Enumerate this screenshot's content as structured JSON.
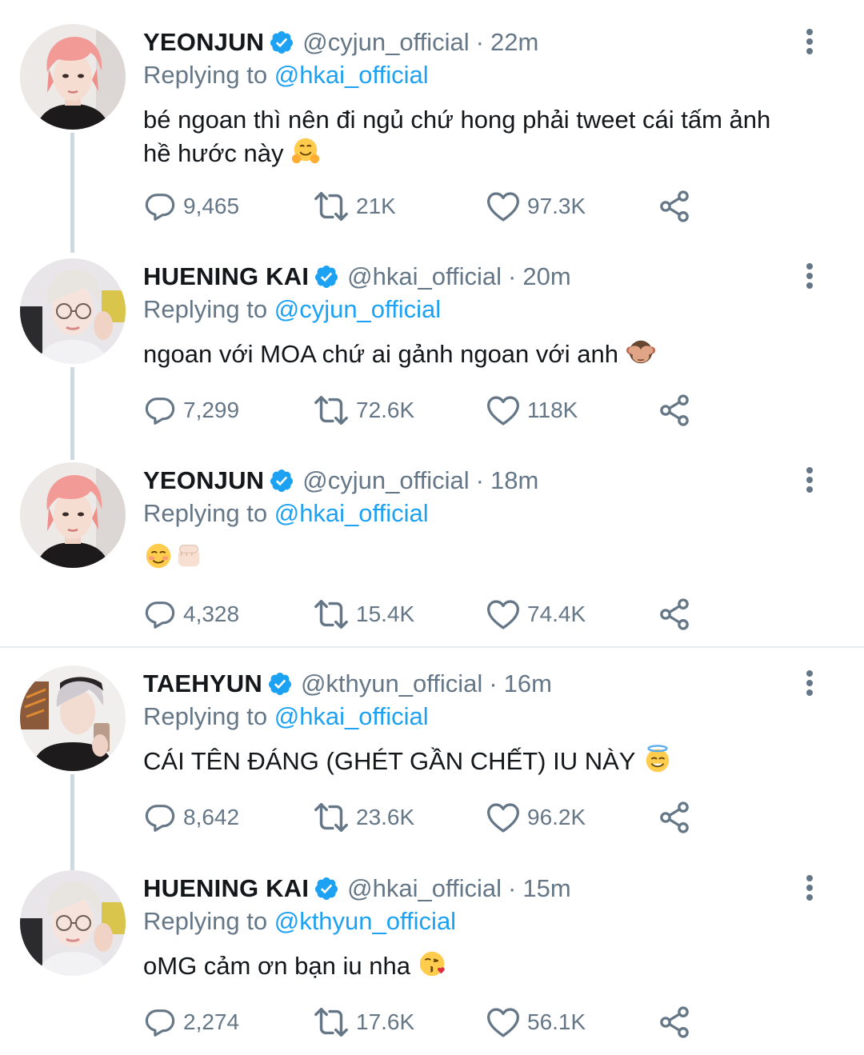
{
  "tweets": [
    {
      "name": "YEONJUN",
      "handle": "@cyjun_official",
      "time": "22m",
      "replying_label": "Replying to",
      "replying_to": "@hkai_official",
      "text_line1": "bé ngoan thì nên đi ngủ chứ hong phải tweet cái tấm ảnh",
      "text_line2": "hề hước này",
      "emoji": "hugging-face",
      "replies": "9,465",
      "retweets": "21K",
      "likes": "97.3K",
      "avatar_icon": "pink-hair-avatar"
    },
    {
      "name": "HUENING KAI",
      "handle": "@hkai_official",
      "time": "20m",
      "replying_label": "Replying to",
      "replying_to": "@cyjun_official",
      "text_line1": "ngoan với MOA chứ ai gảnh ngoan với anh",
      "emoji": "see-no-evil-monkey",
      "replies": "7,299",
      "retweets": "72.6K",
      "likes": "118K",
      "avatar_icon": "blonde-glasses-avatar"
    },
    {
      "name": "YEONJUN",
      "handle": "@cyjun_official",
      "time": "18m",
      "replying_label": "Replying to",
      "replying_to": "@hkai_official",
      "emoji": "smiling-face-and-fist",
      "replies": "4,328",
      "retweets": "15.4K",
      "likes": "74.4K",
      "avatar_icon": "pink-hair-avatar"
    },
    {
      "name": "TAEHYUN",
      "handle": "@kthyun_official",
      "time": "16m",
      "replying_label": "Replying to",
      "replying_to": "@hkai_official",
      "text_line1": "CÁI TÊN ĐÁNG (GHÉT GẦN CHẾT) IU NÀY",
      "emoji": "smiling-face-with-halo",
      "replies": "8,642",
      "retweets": "23.6K",
      "likes": "96.2K",
      "avatar_icon": "mirror-selfie-avatar"
    },
    {
      "name": "HUENING KAI",
      "handle": "@hkai_official",
      "time": "15m",
      "replying_label": "Replying to",
      "replying_to": "@kthyun_official",
      "text_line1": "oMG cảm ơn bạn iu nha",
      "emoji": "face-blowing-kiss",
      "replies": "2,274",
      "retweets": "17.6K",
      "likes": "56.1K",
      "avatar_icon": "blonde-glasses-avatar"
    }
  ],
  "colors": {
    "link": "#1da1f2",
    "muted": "#657786",
    "text": "#14171a",
    "thread_line": "#cfd9de"
  }
}
